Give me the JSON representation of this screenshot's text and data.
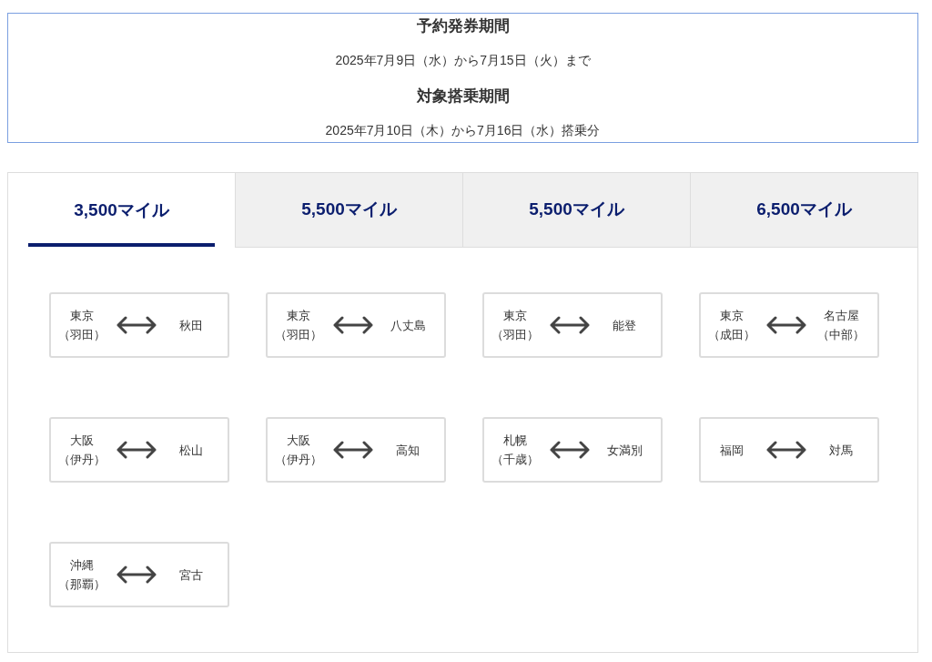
{
  "period_box": {
    "items": [
      {
        "kind": "heading",
        "text": "予約発券期間"
      },
      {
        "kind": "text",
        "text": "2025年7月9日（水）から7月15日（火）まで"
      },
      {
        "kind": "heading",
        "text": "対象搭乗期間"
      },
      {
        "kind": "text",
        "text": "2025年7月10日（木）から7月16日（水）搭乗分"
      }
    ]
  },
  "tabs": [
    {
      "label": "3,500マイル",
      "selected": true
    },
    {
      "label": "5,500マイル",
      "selected": false
    },
    {
      "label": "5,500マイル",
      "selected": false
    },
    {
      "label": "6,500マイル",
      "selected": false
    }
  ],
  "routes": [
    {
      "from": [
        "東京",
        "（羽田）"
      ],
      "to": [
        "秋田"
      ]
    },
    {
      "from": [
        "東京",
        "（羽田）"
      ],
      "to": [
        "八丈島"
      ]
    },
    {
      "from": [
        "東京",
        "（羽田）"
      ],
      "to": [
        "能登"
      ]
    },
    {
      "from": [
        "東京",
        "（成田）"
      ],
      "to": [
        "名古屋",
        "（中部）"
      ]
    },
    {
      "from": [
        "大阪",
        "（伊丹）"
      ],
      "to": [
        "松山"
      ]
    },
    {
      "from": [
        "大阪",
        "（伊丹）"
      ],
      "to": [
        "高知"
      ]
    },
    {
      "from": [
        "札幌",
        "（千歳）"
      ],
      "to": [
        "女満別"
      ]
    },
    {
      "from": [
        "福岡"
      ],
      "to": [
        "対馬"
      ]
    },
    {
      "from": [
        "沖縄",
        "（那覇）"
      ],
      "to": [
        "宮古"
      ]
    }
  ]
}
